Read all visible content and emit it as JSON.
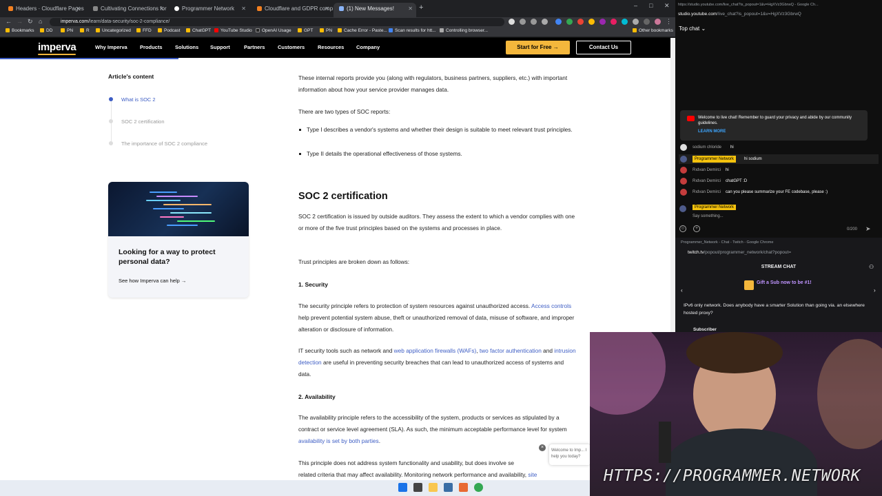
{
  "browser": {
    "tabs": [
      {
        "title": "Headers · Cloudflare Pages docs",
        "active": false
      },
      {
        "title": "Cultivating Connections for Cod",
        "active": false
      },
      {
        "title": "Programmer Network",
        "active": false
      },
      {
        "title": "Cloudflare and GDPR complian",
        "active": false
      },
      {
        "title": "(1) New Messages!",
        "active": true
      }
    ],
    "new_tab": "+",
    "url_host": "imperva.com",
    "url_path": "/learn/data-security/soc-2-compliance/",
    "bookmarks": [
      "Bookmarks",
      "DD",
      "PN",
      "R",
      "Uncategorized",
      "FFD",
      "Podcast",
      "ChatGPT",
      "YouTube Studio",
      "OpenAI Usage",
      "GPT",
      "PN",
      "Cache Error - Paste...",
      "Scan results for htt...",
      "Controlling browser...",
      "Other bookmarks"
    ]
  },
  "site": {
    "logo": "imperva",
    "nav": [
      "Why Imperva",
      "Products",
      "Solutions",
      "Support",
      "Partners",
      "Customers",
      "Resources",
      "Company"
    ],
    "start_btn": "Start for Free →",
    "contact_btn": "Contact Us",
    "toc_title": "Article's content",
    "toc": [
      "What is SOC 2",
      "SOC 2 certification",
      "The importance of SOC 2 compliance"
    ],
    "promo_title": "Looking for a way to protect personal data?",
    "promo_link": "See how Imperva can help →",
    "article": {
      "p1": "These internal reports provide you (along with regulators, business partners, suppliers, etc.) with important information about how your service provider manages data.",
      "p2": "There are two types of SOC reports:",
      "li1": "Type I describes a vendor's systems and whether their design is suitable to meet relevant trust principles.",
      "li2": "Type II details the operational effectiveness of those systems.",
      "h2": "SOC 2 certification",
      "p3": "SOC 2 certification is issued by outside auditors. They assess the extent to which a vendor complies with one or more of the five trust principles based on the systems and processes in place.",
      "p4": "Trust principles are broken down as follows:",
      "h3a": "1. Security",
      "p5a": "The security principle refers to protection of system resources against unauthorized access.",
      "p5link": "Access controls",
      "p5b": "help prevent potential system abuse, theft or unauthorized removal of data, misuse of software, and improper alteration or disclosure of information.",
      "p6a": "IT security tools such as network and",
      "p6link1": "web application firewalls (WAFs)",
      "p6link2": "two factor authentication",
      "p6and": "and",
      "p6link3": "intrusion detection",
      "p6b": "are useful in preventing security breaches that can lead to unauthorized access of systems and data.",
      "h3b": "2. Availability",
      "p7a": "The availability principle refers to the accessibility of the system, products or services as stipulated by a contract or service level agreement (SLA). As such, the minimum acceptable performance level for system",
      "p7link": "availability is set by both parties",
      "p8a": "This principle does not address system functionality and usability, but does involve se",
      "p8b": "related criteria that may affect availability. Monitoring network performance and availability,",
      "p8link": "site"
    },
    "chat_bubble": "Welcome to Imp... I help you today?"
  },
  "youtube": {
    "title": "https://studio.youtube.com/live_chat?is_popout=1&v=HgXVz3GbrwQ - Google Ch...",
    "url_host": "studio.youtube.com",
    "url_path": "/live_chat?is_popout=1&v=HgXVz3GbrwQ",
    "header": "Top chat",
    "welcome": "Welcome to live chat! Remember to guard your privacy and abide by our community guidelines.",
    "learn_more": "LEARN MORE",
    "messages": [
      {
        "name": "sodium chloride",
        "text": "hi",
        "mod": false
      },
      {
        "name": "Programmer Network",
        "text": "hi sodium",
        "mod": true
      },
      {
        "name": "Rıdvan Demirci",
        "text": "hi",
        "mod": false
      },
      {
        "name": "Rıdvan Demirci",
        "text": "chatGPT :D",
        "mod": false
      },
      {
        "name": "Rıdvan Demirci",
        "text": "can you please summarize your FE codebase, please :)",
        "mod": false
      }
    ],
    "input_name": "Programmer Network",
    "input_placeholder": "Say something...",
    "counter": "0/200"
  },
  "twitch": {
    "title": "Programmer_Network - Chat - Twitch - Google Chrome",
    "url_host": "twitch.tv",
    "url_path": "/popout/programmer_network/chat?popout=",
    "header": "STREAM CHAT",
    "gift": "Gift a Sub now to be #1!",
    "message": "IPv6 only network. Does anybody have a smarter Solution than going via. an elsewhere hosted proxy?",
    "sub_label": "Subscriber"
  },
  "watermark": "HTTPS://PROGRAMMER.NETWORK",
  "colors": {
    "accent": "#3d5dc4",
    "cta": "#f4b73c",
    "mod_badge": "#f4c20d"
  }
}
